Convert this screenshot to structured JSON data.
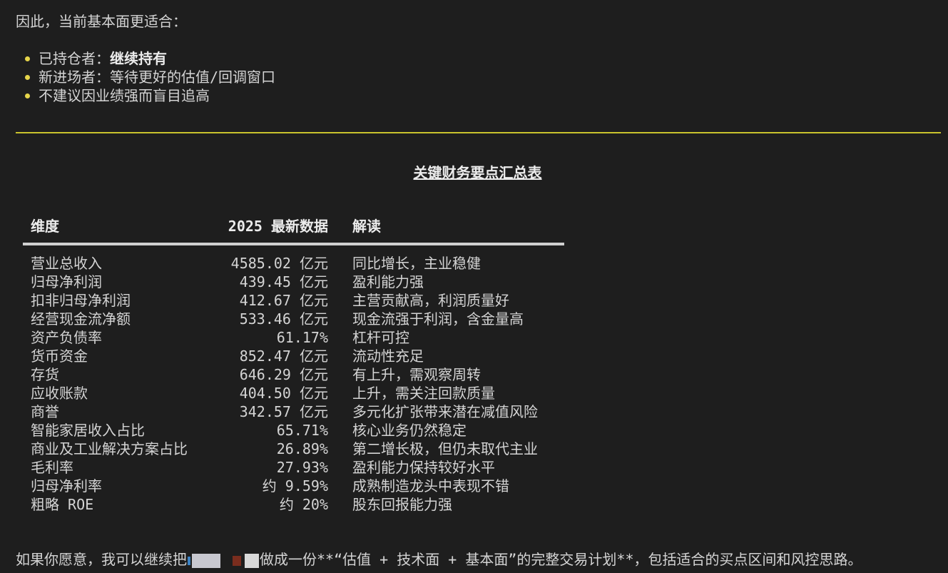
{
  "intro": "因此，当前基本面更适合：",
  "bullets": [
    {
      "prefix": "已持仓者：",
      "strong": "继续持有"
    },
    {
      "prefix": "新进场者：等待更好的估值/回调窗口",
      "strong": ""
    },
    {
      "prefix": "不建议因业绩强而盲目追高",
      "strong": ""
    }
  ],
  "colors": {
    "background": "#1e1e1e",
    "text": "#d4d4d4",
    "accent": "#c9c32d",
    "bullet": "#e6d54a"
  },
  "table": {
    "title": "关键财务要点汇总表",
    "headers": [
      "维度",
      "2025 最新数据",
      "解读"
    ],
    "rows": [
      [
        "营业总收入",
        "4585.02 亿元",
        "同比增长，主业稳健"
      ],
      [
        "归母净利润",
        "439.45 亿元",
        "盈利能力强"
      ],
      [
        "扣非归母净利润",
        "412.67 亿元",
        "主营贡献高，利润质量好"
      ],
      [
        "经营现金流净额",
        "533.46 亿元",
        "现金流强于利润，含金量高"
      ],
      [
        "资产负债率",
        "61.17%",
        "杠杆可控"
      ],
      [
        "货币资金",
        "852.47 亿元",
        "流动性充足"
      ],
      [
        "存货",
        "646.29 亿元",
        "有上升，需观察周转"
      ],
      [
        "应收账款",
        "404.50 亿元",
        "上升，需关注回款质量"
      ],
      [
        "商誉",
        "342.57 亿元",
        "多元化扩张带来潜在减值风险"
      ],
      [
        "智能家居收入占比",
        "65.71%",
        "核心业务仍然稳定"
      ],
      [
        "商业及工业解决方案占比",
        "26.89%",
        "第二增长极，但仍未取代主业"
      ],
      [
        "毛利率",
        "27.93%",
        "盈利能力保持较好水平"
      ],
      [
        "归母净利率",
        "约 9.59%",
        "成熟制造龙头中表现不错"
      ],
      [
        "粗略 ROE",
        "约 20%",
        "股东回报能力强"
      ]
    ]
  },
  "footer": {
    "before": "如果你愿意，我可以继续把",
    "after": "做成一份**“估值 + 技术面 + 基本面”的完整交易计划**，包括适合的买点区间和风控思路。"
  }
}
